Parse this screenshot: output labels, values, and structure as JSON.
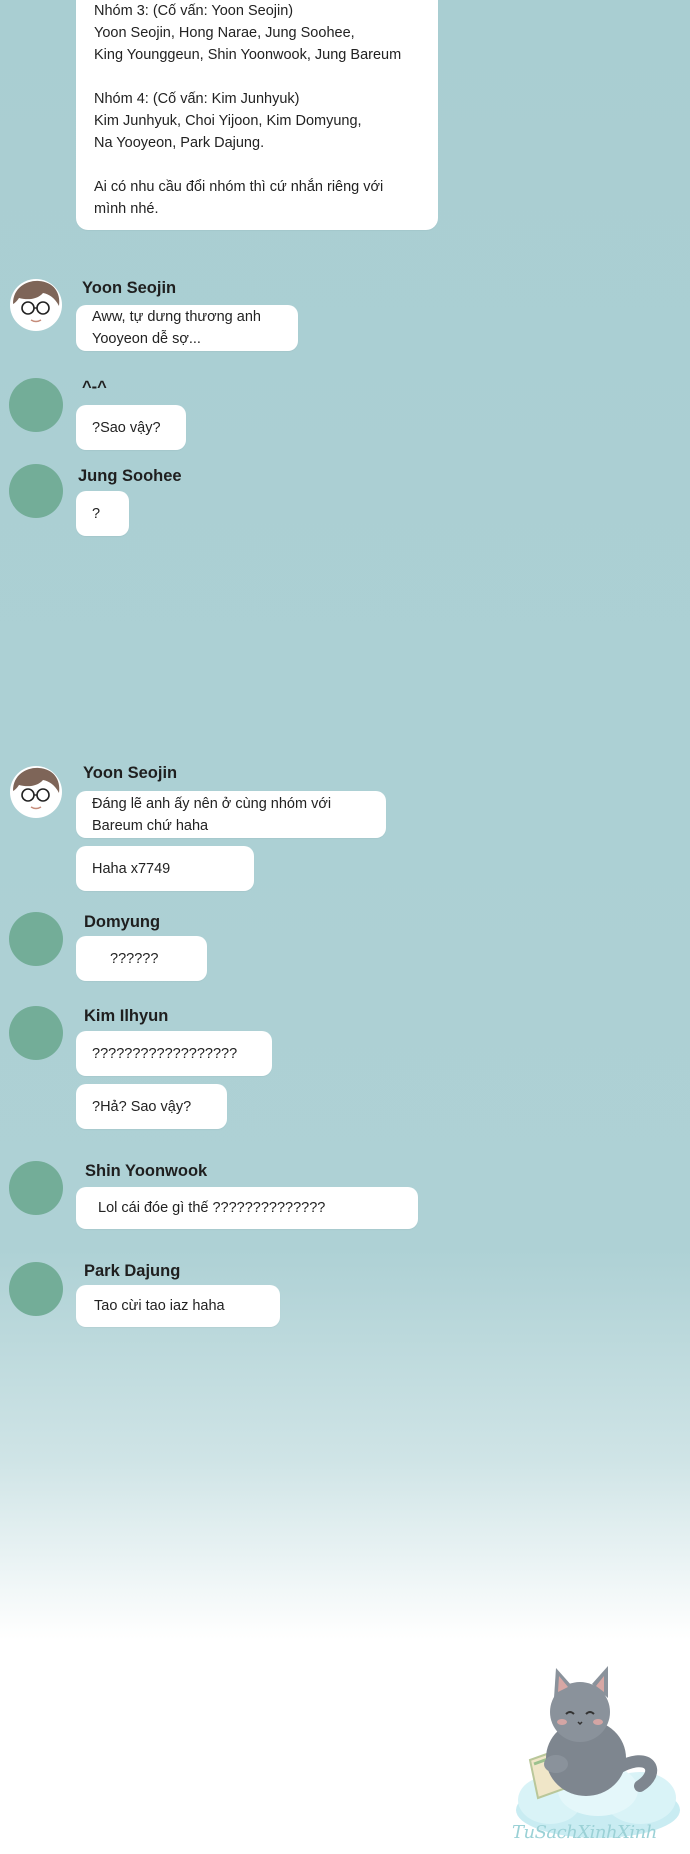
{
  "announcement": {
    "line1": "Nhóm 3: (Cố vấn: Yoon Seojin)\nYoon Seojin, Hong Narae, Jung Soohee,\nKing Younggeun, Shin Yoonwook, Jung Bareum",
    "line2": "Nhóm 4: (Cố vấn: Kim Junhyuk)\nKim Junhyuk, Choi Yijoon, Kim Domyung,\nNa Yooyeon, Park Dajung.",
    "line3": "Ai có nhu cầu đổi nhóm thì cứ nhắn riêng với\nmình nhé."
  },
  "messages": [
    {
      "sender": "Yoon Seojin",
      "bubbles": [
        "Aww, tự dưng thương anh\nYooyeon dễ sợ..."
      ]
    },
    {
      "sender": "^-^",
      "bubbles": [
        "?Sao vậy?"
      ]
    },
    {
      "sender": "Jung Soohee",
      "bubbles": [
        "?"
      ]
    },
    {
      "sender": "Yoon Seojin",
      "bubbles": [
        "Đáng lẽ anh ấy nên ở cùng nhóm với\nBareum chứ haha",
        "Haha x7749"
      ]
    },
    {
      "sender": "Domyung",
      "bubbles": [
        "??????"
      ]
    },
    {
      "sender": "Kim Ilhyun",
      "bubbles": [
        "??????????????????",
        "?Hả? Sao vậy?"
      ]
    },
    {
      "sender": "Shin Yoonwook",
      "bubbles": [
        "Lol cái đóe gì thế ??????????????"
      ]
    },
    {
      "sender": "Park Dajung",
      "bubbles": [
        "Tao cừi tao iaz haha"
      ]
    }
  ],
  "watermark": "TuSachXinhXinh",
  "colors": {
    "background": "#a9ced2",
    "bubble": "#ffffff",
    "avatar": "#73ad98",
    "watermark": "#9bd1d6"
  }
}
